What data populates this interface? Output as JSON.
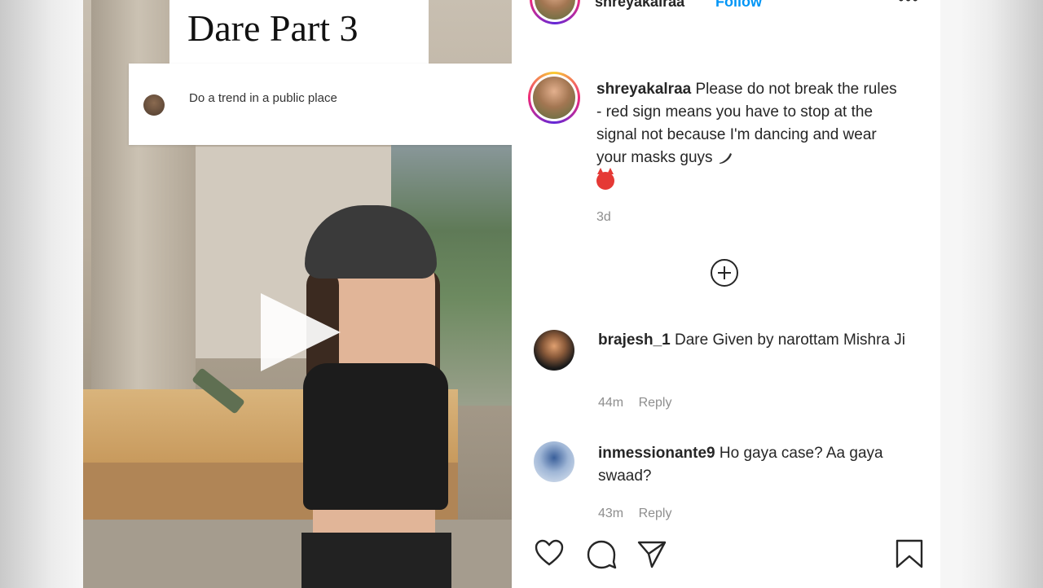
{
  "post": {
    "title_card": "Dare Part 3",
    "dare_prompt": "Do a trend in a public place"
  },
  "header": {
    "username": "shreyakalraa",
    "follow_label": "Follow",
    "more_glyph": "•••"
  },
  "caption": {
    "username": "shreyakalraa",
    "text": "Please do not break the rules - red sign means you have to stop at the signal not because I'm dancing and wear your masks guys",
    "time": "3d"
  },
  "load_more_icon": "plus-circle-icon",
  "comments": [
    {
      "username": "brajesh_1",
      "text": "Dare Given by narottam Mishra Ji",
      "time": "44m",
      "reply": "Reply"
    },
    {
      "username": "inmessionante9",
      "text": "Ho gaya case? Aa gaya swaad?",
      "time": "43m",
      "reply": "Reply"
    }
  ],
  "actions": {
    "like_icon": "heart-icon",
    "comment_icon": "comment-icon",
    "share_icon": "send-icon",
    "save_icon": "bookmark-icon"
  },
  "colors": {
    "follow_blue": "#0095f6",
    "meta_gray": "#8e8e8e",
    "text_dark": "#262626"
  }
}
